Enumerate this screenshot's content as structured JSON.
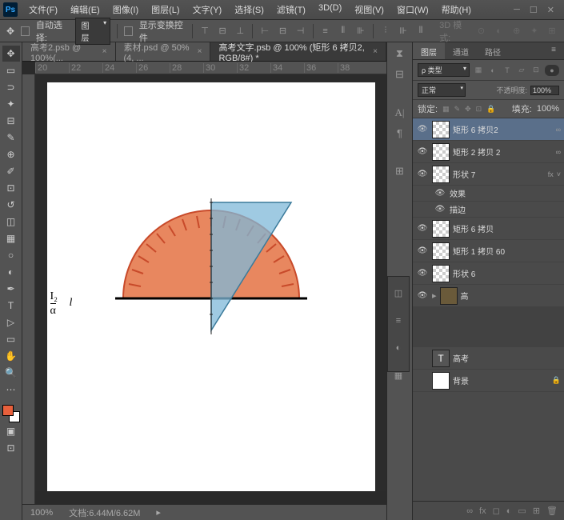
{
  "app": {
    "name": "Ps"
  },
  "menu": [
    "文件(F)",
    "编辑(E)",
    "图像(I)",
    "图层(L)",
    "文字(Y)",
    "选择(S)",
    "滤镜(T)",
    "3D(D)",
    "视图(V)",
    "窗口(W)",
    "帮助(H)"
  ],
  "options": {
    "auto_select": "自动选择:",
    "group": "图层",
    "show_transform": "显示变换控件",
    "mode3d": "3D 模式:"
  },
  "tabs": [
    {
      "label": "高考2.psb @ 100%(...",
      "active": false
    },
    {
      "label": "素材.psd @ 50% (4, ...",
      "active": false
    },
    {
      "label": "高考文字.psb @ 100% (矩形 6  拷贝2, RGB/8#) *",
      "active": true
    }
  ],
  "ruler_ticks": [
    "20",
    "22",
    "24",
    "26",
    "28",
    "30",
    "32",
    "34",
    "36",
    "38"
  ],
  "status": {
    "zoom": "100%",
    "doc": "文档:6.44M/6.62M"
  },
  "panel": {
    "tabs": [
      "图层",
      "通道",
      "路径"
    ],
    "kind": "ρ 类型",
    "blend": "正常",
    "opacity_lbl": "不透明度:",
    "opacity": "100%",
    "lock_lbl": "锁定:",
    "fill_lbl": "填充:",
    "fill": "100%"
  },
  "layers": [
    {
      "name": "矩形 6  拷贝2",
      "sel": true,
      "link": "∞"
    },
    {
      "name": "矩形 2 拷贝 2",
      "link": "∞"
    },
    {
      "name": "形状 7",
      "fx": "fx"
    },
    {
      "name": "效果",
      "sub": true
    },
    {
      "name": "描边",
      "sub": true
    },
    {
      "name": "矩形 6 拷贝"
    },
    {
      "name": "矩形 1 拷贝 60"
    },
    {
      "name": "形状 6"
    },
    {
      "name": "高",
      "folder": true
    },
    {
      "name": "高考",
      "txt": true
    },
    {
      "name": "背景",
      "lock": "🔒",
      "white": true
    }
  ],
  "canvas": {
    "label_i2": "I₂",
    "label_alpha": "α",
    "label_l": "l"
  }
}
